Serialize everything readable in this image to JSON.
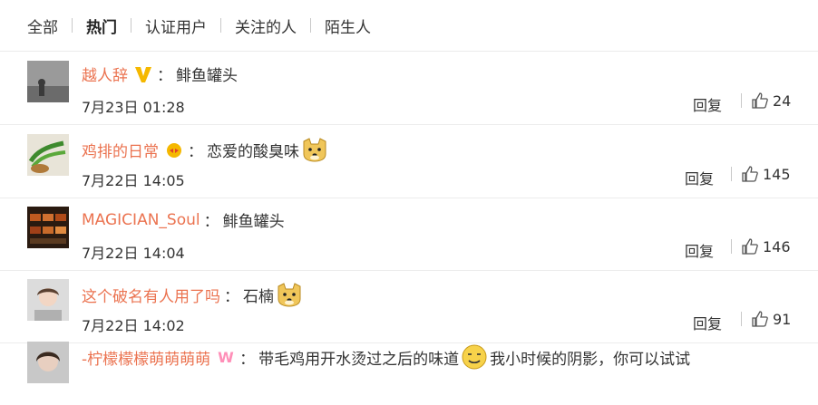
{
  "filters": {
    "all": "全部",
    "hot": "热门",
    "verified": "认证用户",
    "following": "关注的人",
    "strangers": "陌生人"
  },
  "comments": [
    {
      "user": "越人辞",
      "badge": "vip-v-icon",
      "colon": "：",
      "text": "鲱鱼罐头",
      "emoji_after": "",
      "text2": "",
      "time": "7月23日 01:28",
      "reply": "回复",
      "likes": "24"
    },
    {
      "user": "鸡排的日常",
      "badge": "fan-badge-icon",
      "colon": "：",
      "text": "恋爱的酸臭味",
      "emoji_after": "doge-emoji",
      "text2": "",
      "time": "7月22日 14:05",
      "reply": "回复",
      "likes": "145"
    },
    {
      "user": "MAGICIAN_Soul",
      "badge": "",
      "colon": "：",
      "text": "鲱鱼罐头",
      "emoji_after": "",
      "text2": "",
      "time": "7月22日 14:04",
      "reply": "回复",
      "likes": "146"
    },
    {
      "user": "这个破名有人用了吗",
      "badge": "",
      "colon": "：",
      "text": "石楠",
      "emoji_after": "doge-emoji",
      "text2": "",
      "time": "7月22日 14:02",
      "reply": "回复",
      "likes": "91"
    },
    {
      "user": "-柠檬檬檬萌萌萌萌",
      "badge": "w-badge-icon",
      "colon": "：",
      "text": "带毛鸡用开水烫过之后的味道",
      "emoji_after": "awkward-smile-emoji",
      "text2": "我小时候的阴影，你可以试试",
      "time": "",
      "reply": "",
      "likes": ""
    }
  ],
  "colors": {
    "username": "#eb7350",
    "text": "#333333",
    "divider": "#ececec",
    "badge_gold": "#f5b800"
  }
}
